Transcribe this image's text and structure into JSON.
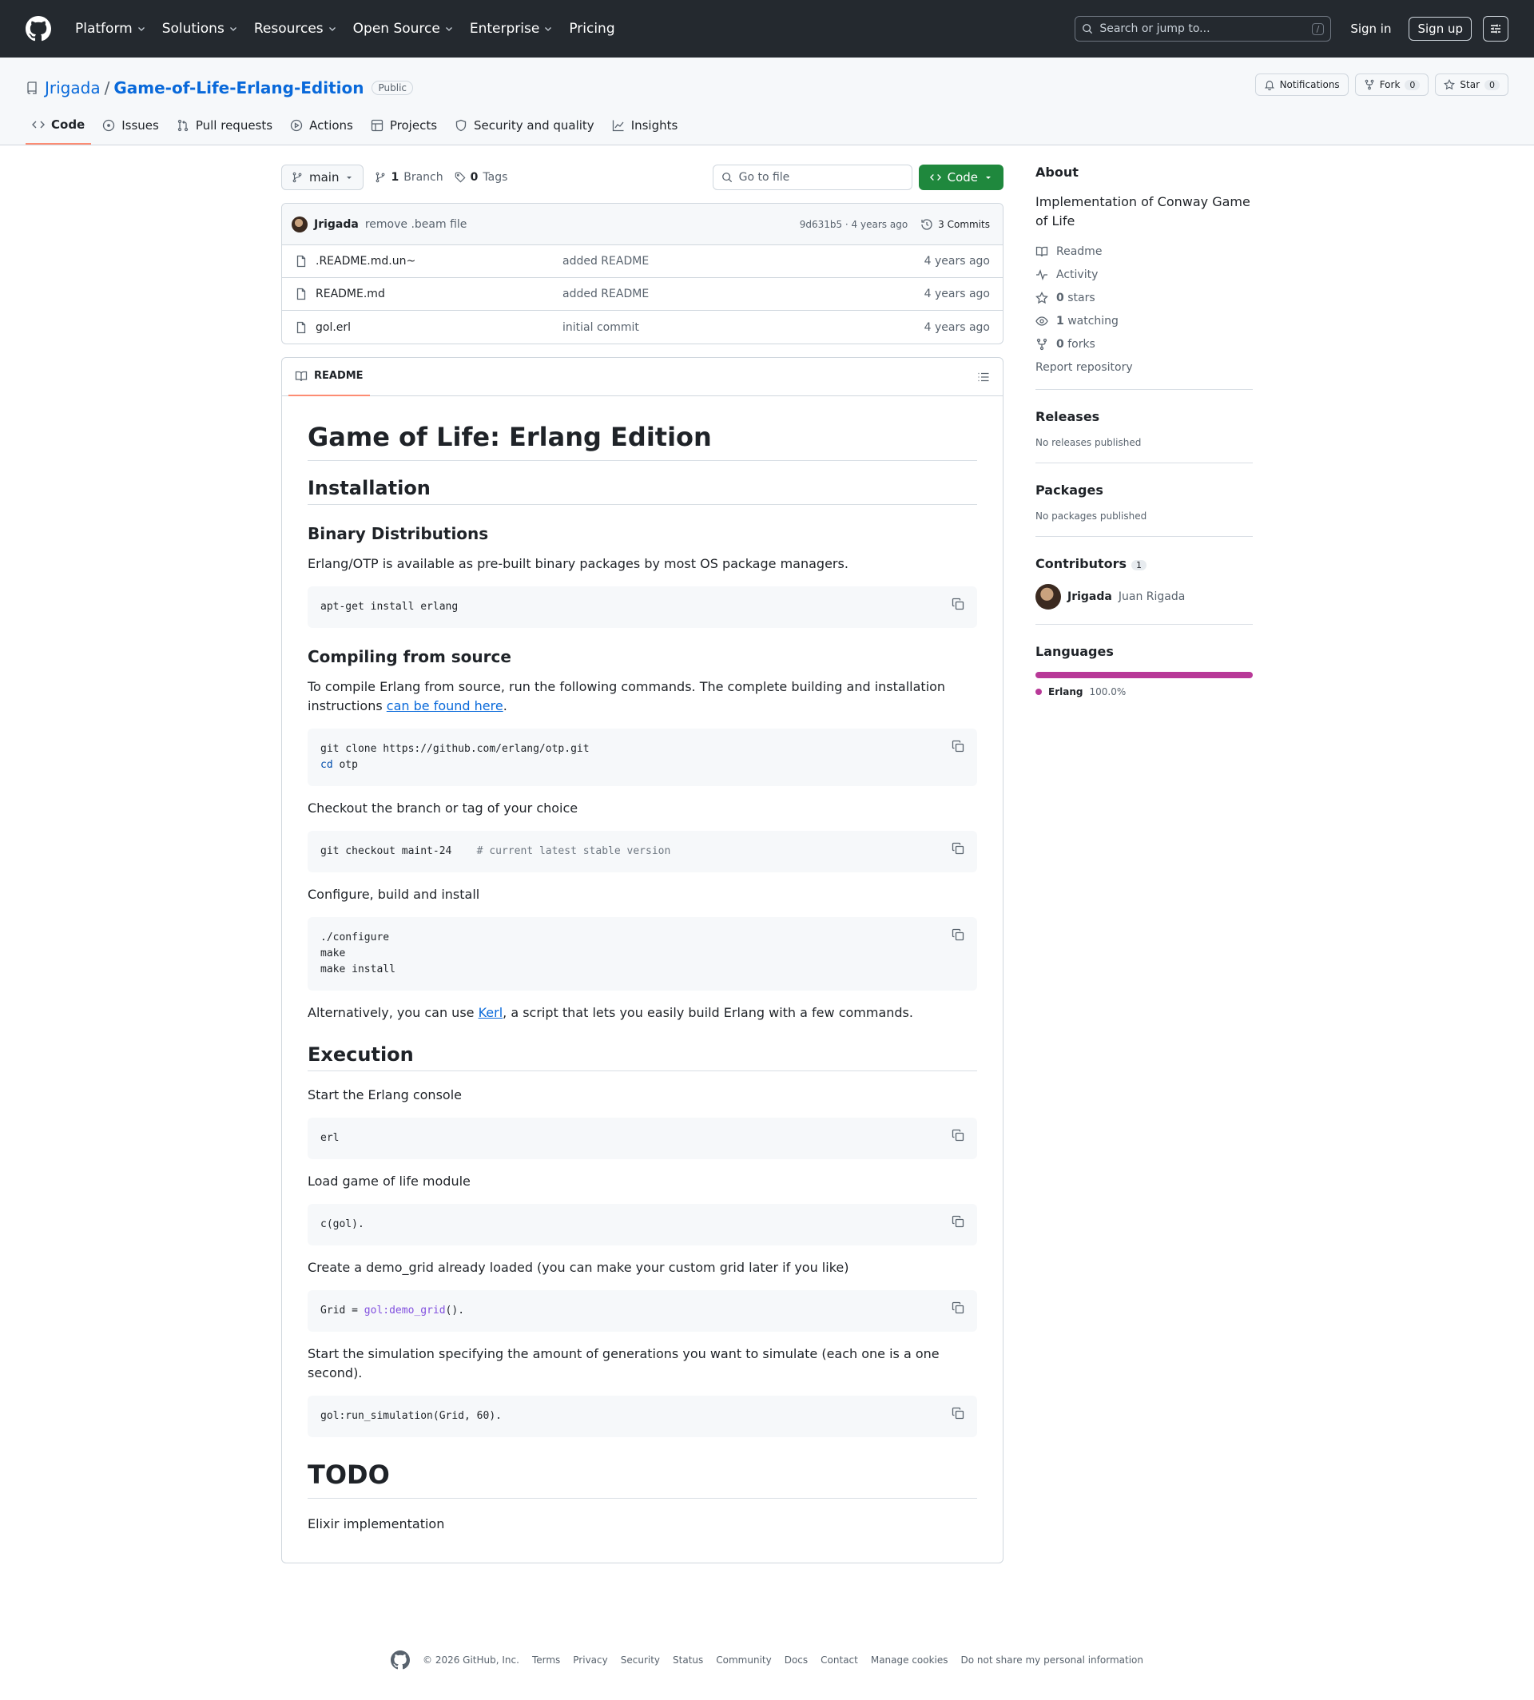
{
  "global_nav": {
    "items": [
      "Platform",
      "Solutions",
      "Resources",
      "Open Source",
      "Enterprise",
      "Pricing"
    ],
    "search_placeholder": "Search or jump to...",
    "search_shortcut": "/",
    "sign_in": "Sign in",
    "sign_up": "Sign up"
  },
  "repo": {
    "owner": "Jrigada",
    "separator": "/",
    "name": "Game-of-Life-Erlang-Edition",
    "visibility": "Public",
    "notifications_label": "Notifications",
    "fork_label": "Fork",
    "fork_count": "0",
    "star_label": "Star",
    "star_count": "0",
    "tabs": [
      "Code",
      "Issues",
      "Pull requests",
      "Actions",
      "Projects",
      "Security and quality",
      "Insights"
    ]
  },
  "toolbar": {
    "branch": "main",
    "branches_count": "1",
    "branches_label": "Branch",
    "tags_count": "0",
    "tags_label": "Tags",
    "go_to_file": "Go to file",
    "code_button": "Code"
  },
  "latest_commit": {
    "author": "Jrigada",
    "message": "remove .beam file",
    "meta": "9d631b5 · 4 years ago",
    "commits": "3 Commits"
  },
  "files": [
    {
      "name": ".README.md.un~",
      "message": "added README",
      "age": "4 years ago"
    },
    {
      "name": "README.md",
      "message": "added README",
      "age": "4 years ago"
    },
    {
      "name": "gol.erl",
      "message": "initial commit",
      "age": "4 years ago"
    }
  ],
  "readme": {
    "tab_label": "README",
    "title": "Game of Life: Erlang Edition",
    "installation": "Installation",
    "binary_title": "Binary Distributions",
    "binary_text": "Erlang/OTP is available as pre-built binary packages by most OS package managers.",
    "binary_code": "apt-get install erlang",
    "compile_title": "Compiling from source",
    "compile_text_before": "To compile Erlang from source, run the following commands. The complete building and installation instructions ",
    "compile_link": "can be found here",
    "compile_text_after": ".",
    "clone_line1": "git clone https://github.com/erlang/otp.git",
    "clone_line2_kw": "cd",
    "clone_line2_rest": " otp",
    "checkout_text": "Checkout the branch or tag of your choice",
    "checkout_code": "git checkout maint-24    ",
    "checkout_comment": "# current latest stable version",
    "configure_text": "Configure, build and install",
    "configure_code": "./configure\nmake\nmake install",
    "kerl_before": "Alternatively, you can use ",
    "kerl_link": "Kerl",
    "kerl_after": ", a script that lets you easily build Erlang with a few commands.",
    "execution": "Execution",
    "start_text": "Start the Erlang console",
    "start_code": "erl",
    "load_text": "Load game of life module",
    "load_code": "c(gol).",
    "grid_text": "Create a demo_grid already loaded (you can make your custom grid later if you like)",
    "grid_code_before": "Grid = ",
    "grid_code_fn": "gol:demo_grid",
    "grid_code_after": "().",
    "sim_text": "Start the simulation specifying the amount of generations you want to simulate (each one is a one second).",
    "sim_code": "gol:run_simulation(Grid, 60).",
    "todo": "TODO",
    "todo_text": "Elixir implementation"
  },
  "sidebar": {
    "about_title": "About",
    "description": "Implementation of Conway Game of Life",
    "readme": "Readme",
    "activity": "Activity",
    "stars_count": "0",
    "stars_label": "stars",
    "watching_count": "1",
    "watching_label": "watching",
    "forks_count": "0",
    "forks_label": "forks",
    "report": "Report repository",
    "releases_title": "Releases",
    "releases_text": "No releases published",
    "packages_title": "Packages",
    "packages_text": "No packages published",
    "contributors_title": "Contributors",
    "contributors_count": "1",
    "contributor_login": "Jrigada",
    "contributor_name": "Juan Rigada",
    "languages_title": "Languages",
    "language_name": "Erlang",
    "language_percent": "100.0%",
    "language_color": "#b83998"
  },
  "footer": {
    "copyright": "© 2026 GitHub, Inc.",
    "links": [
      "Terms",
      "Privacy",
      "Security",
      "Status",
      "Community",
      "Docs",
      "Contact",
      "Manage cookies",
      "Do not share my personal information"
    ]
  },
  "colors": {
    "header_bg": "#24292f",
    "link": "#0969da",
    "code_button": "#1f883d",
    "active_tab_underline": "#fd8c73"
  }
}
